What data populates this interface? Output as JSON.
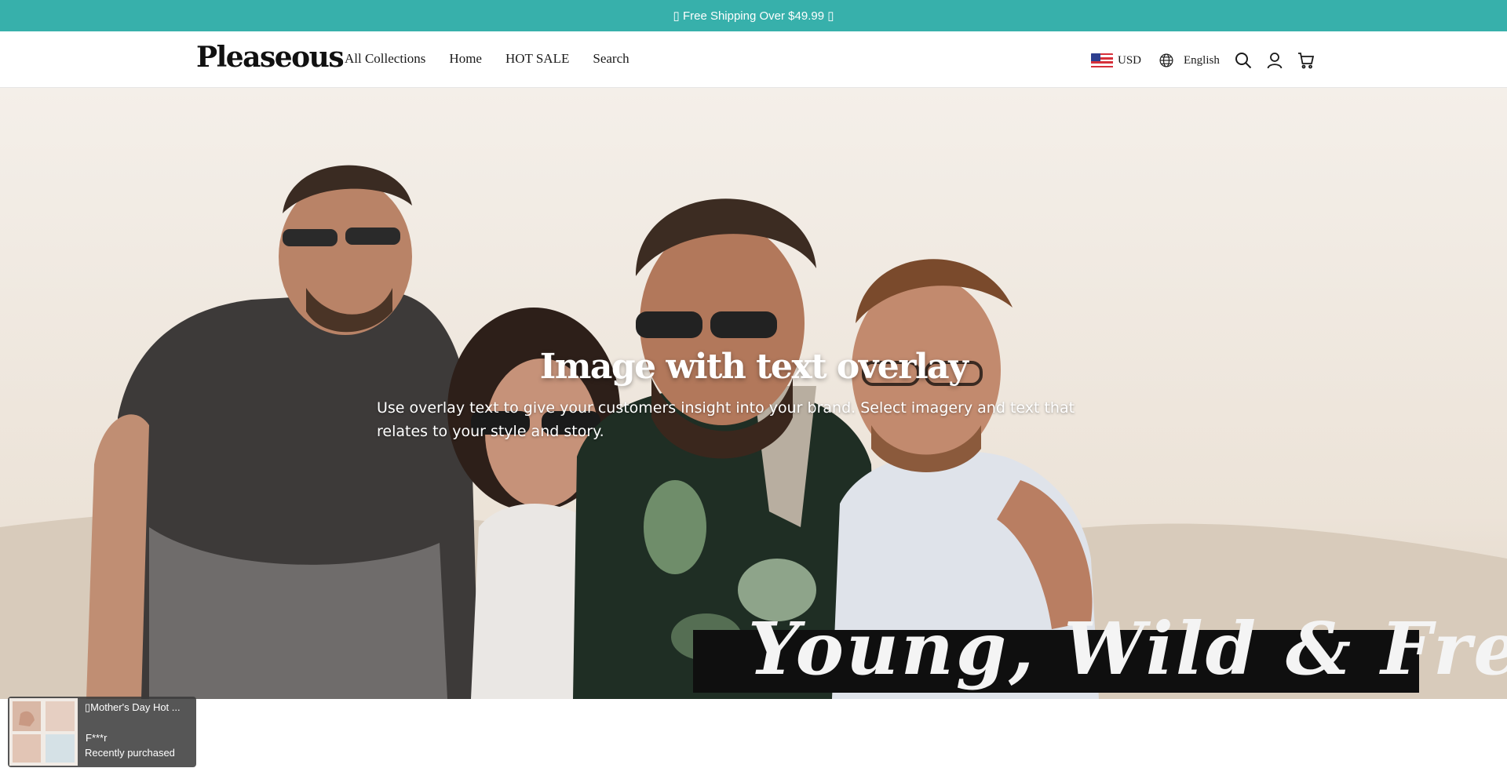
{
  "announcement": {
    "text": "▯ Free Shipping Over $49.99 ▯"
  },
  "header": {
    "logo": "Pleaseous",
    "nav": [
      "All Collections",
      "Home",
      "HOT SALE",
      "Search"
    ],
    "currency": "USD",
    "language": "English",
    "icons": {
      "flag": "us-flag-icon",
      "language": "globe-icon",
      "search": "search-icon",
      "account": "account-icon",
      "cart": "cart-icon"
    }
  },
  "hero": {
    "title": "Image with text overlay",
    "text": "Use overlay text to give your customers insight into your brand. Select imagery and text that relates to your style and story.",
    "banner_text": "Young, Wild & Free"
  },
  "popup": {
    "title": "▯Mother's Day Hot ...",
    "name": "F***r",
    "status": "Recently purchased"
  },
  "colors": {
    "announcement_bg": "#37b0ab",
    "text_dark": "#1a1a1a",
    "popup_bg": "#3a3a3a"
  }
}
